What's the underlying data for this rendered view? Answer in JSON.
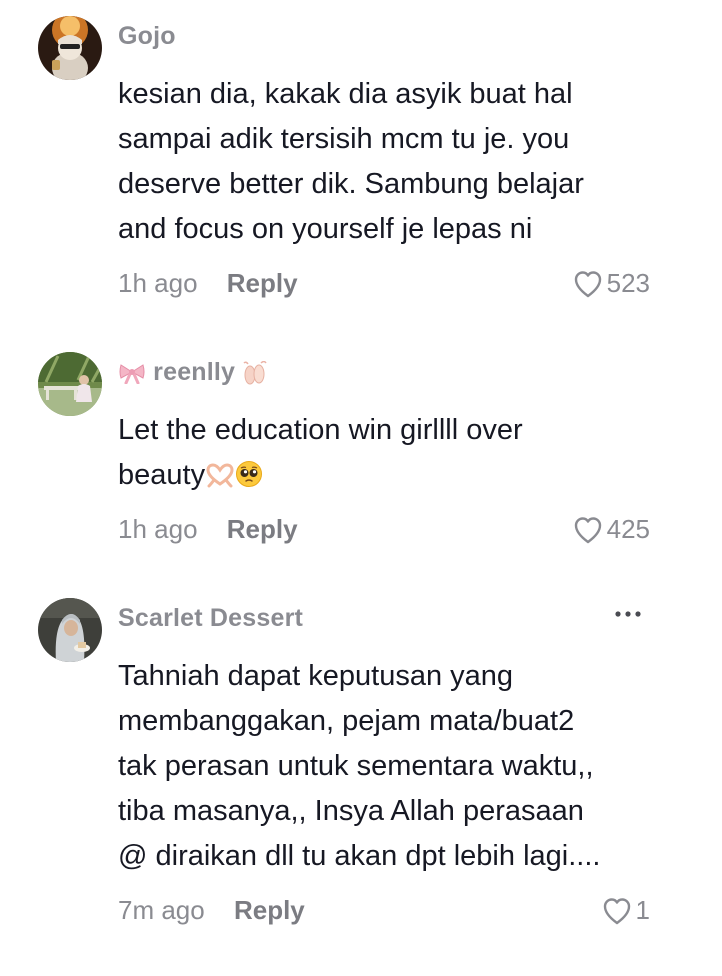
{
  "comments": [
    {
      "username": "Gojo",
      "text_lines": [
        "kesian dia, kakak dia asyik buat hal",
        "sampai adik tersisih mcm tu je. you",
        "deserve better dik. Sambung belajar",
        "and focus on yourself je lepas ni"
      ],
      "time": "1h ago",
      "reply": "Reply",
      "likes": "523"
    },
    {
      "username": "reenlly",
      "text_lines": [
        "Let the education win girllll over",
        "beauty"
      ],
      "time": "1h ago",
      "reply": "Reply",
      "likes": "425"
    },
    {
      "username": "Scarlet Dessert",
      "text_lines": [
        "Tahniah dapat keputusan yang",
        "membanggakan, pejam mata/buat2",
        "tak perasan untuk sementara waktu,,",
        "tiba masanya,, Insya Allah perasaan",
        "@ diraikan dll tu akan dpt lebih lagi...."
      ],
      "time": "7m ago",
      "reply": "Reply",
      "likes": "1"
    }
  ],
  "icons": {
    "like": "heart-outline-icon",
    "more": "more-dots-icon",
    "bow": "pink-bow-emoji",
    "shoes": "ballet-shoes-emoji",
    "heart_hands": "heart-hands-emoji",
    "pleading": "pleading-face-emoji"
  },
  "colors": {
    "text": "#161823",
    "secondary": "#8a8b91"
  }
}
